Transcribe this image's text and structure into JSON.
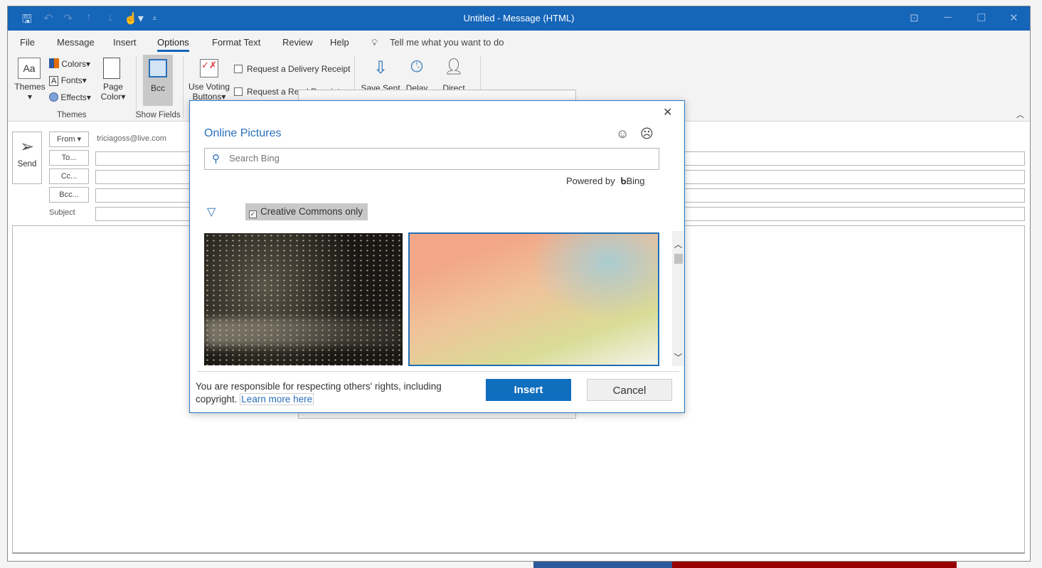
{
  "window": {
    "title": "Untitled  -  Message (HTML)",
    "accent": "#1565b9"
  },
  "menu": {
    "items": [
      "File",
      "Message",
      "Insert",
      "Options",
      "Format Text",
      "Review",
      "Help"
    ],
    "active": "Options",
    "tell_me": "Tell me what you want to do"
  },
  "ribbon": {
    "themes": "Themes",
    "colors": "Colors",
    "fonts": "Fonts",
    "effects": "Effects",
    "page_color_1": "Page",
    "page_color_2": "Color",
    "themes_group": "Themes",
    "bcc": "Bcc",
    "show_fields_group": "Show Fields",
    "voting_1": "Use Voting",
    "voting_2": "Buttons",
    "delivery_receipt": "Request a Delivery Receipt",
    "read_receipt": "Request a Read Receipt",
    "save_sent": "Save Sent",
    "delay": "Delay",
    "direct": "Direct"
  },
  "compose": {
    "send": "Send",
    "from": "From",
    "from_value": "triciagoss@live.com",
    "to": "To...",
    "cc": "Cc...",
    "bcc": "Bcc...",
    "subject": "Subject"
  },
  "dialog": {
    "title": "Online Pictures",
    "search_placeholder": "Search Bing",
    "powered_by": "Powered by",
    "bing": "Bing",
    "filter_label": "Creative Commons only",
    "filter_checked": true,
    "disclaimer": "You are responsible for respecting others' rights, including copyright.",
    "learn_more": "Learn more here",
    "insert": "Insert",
    "cancel": "Cancel",
    "accent": "#106ebe"
  }
}
